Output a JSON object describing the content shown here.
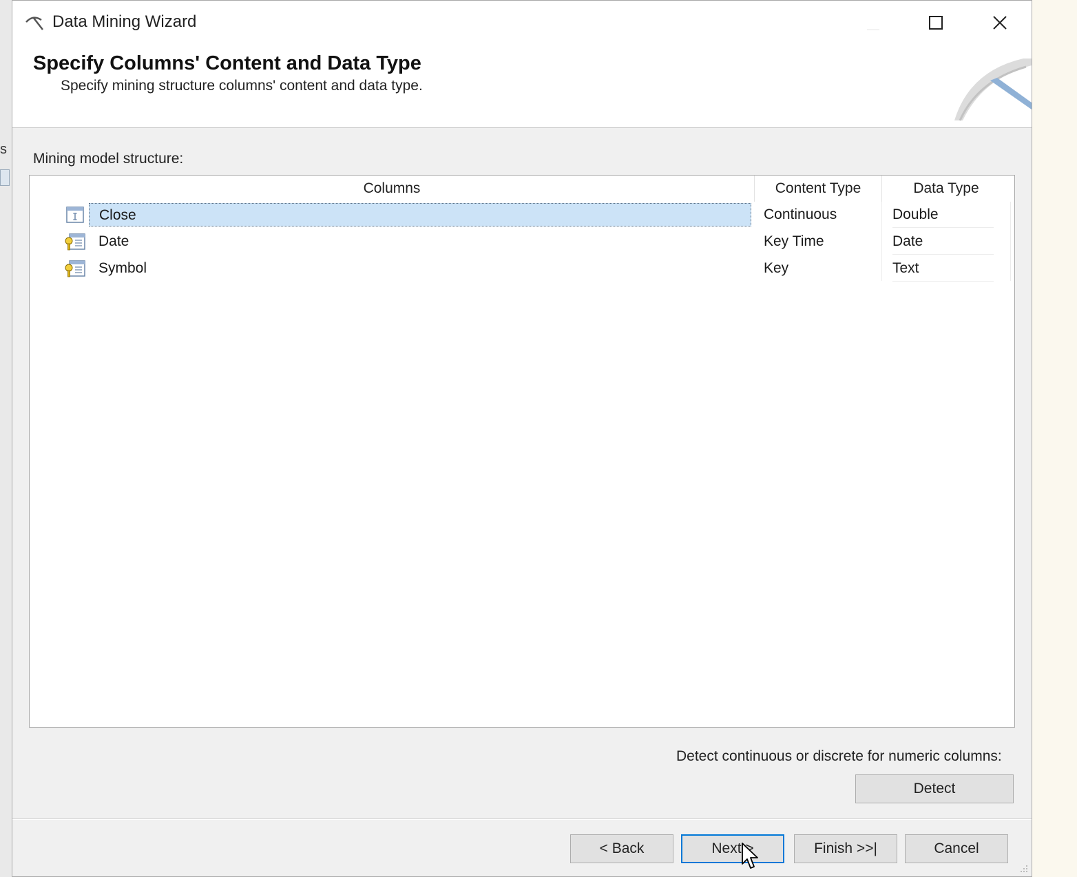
{
  "window": {
    "title": "Data Mining Wizard",
    "icon": "pickaxe-icon",
    "controls": [
      "minimize-icon",
      "maximize-icon",
      "close-icon"
    ]
  },
  "header": {
    "title": "Specify Columns' Content and Data Type",
    "subtitle": "Specify mining structure columns' content and data type."
  },
  "section_label": "Mining model structure:",
  "grid": {
    "headers": {
      "columns": "Columns",
      "content_type": "Content Type",
      "data_type": "Data Type"
    },
    "rows": [
      {
        "name": "Close",
        "content_type": "Continuous",
        "data_type": "Double",
        "icon": "column-icon",
        "selected": true
      },
      {
        "name": "Date",
        "content_type": "Key Time",
        "data_type": "Date",
        "icon": "key-column-icon",
        "selected": false
      },
      {
        "name": "Symbol",
        "content_type": "Key",
        "data_type": "Text",
        "icon": "key-column-icon",
        "selected": false
      }
    ]
  },
  "detect": {
    "label": "Detect continuous or discrete for numeric columns:",
    "button": "Detect"
  },
  "footer": {
    "back": "< Back",
    "next": "Next >",
    "finish": "Finish >>|",
    "cancel": "Cancel"
  },
  "colors": {
    "selection": "#cce3f7",
    "accent": "#0078d7",
    "dialog_bg": "#f0f0f0"
  }
}
